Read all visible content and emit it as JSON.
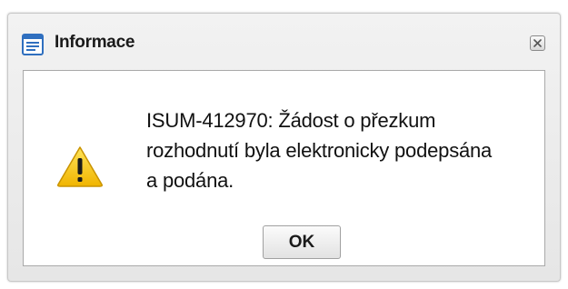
{
  "dialog": {
    "title": "Informace",
    "title_icon": "window-icon",
    "close_icon": "close-icon",
    "warning_icon": "warning-icon",
    "message_lines": [
      "ISUM-412970: Žádost o přezkum",
      "rozhodnutí byla elektronicky podepsána",
      "a podána."
    ],
    "ok_label": "OK"
  },
  "colors": {
    "icon_blue": "#2f6fbf",
    "warning_yellow": "#f5c400",
    "border": "#a9a9a9"
  }
}
